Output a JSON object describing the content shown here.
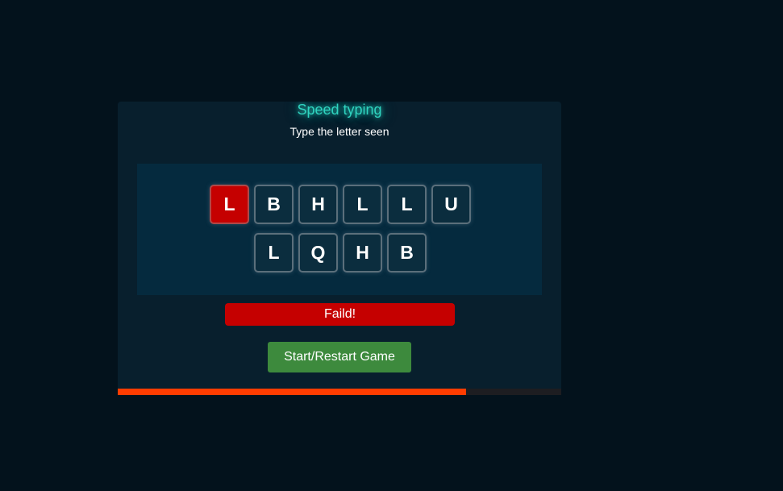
{
  "game": {
    "title": "Speed typing",
    "subtitle": "Type the letter seen",
    "letters_row1": [
      "L",
      "B",
      "H",
      "L",
      "L",
      "U"
    ],
    "letters_row2": [
      "L",
      "Q",
      "H",
      "B"
    ],
    "active_index": 0,
    "status": "Faild!",
    "start_button": "Start/Restart Game",
    "time_remaining_fraction": 0.785
  },
  "colors": {
    "background": "#03121c",
    "panel": "#081f2d",
    "board": "#052a3e",
    "title_glow": "#2fd4c0",
    "active_tile": "#c50000",
    "status_fail": "#c50000",
    "start_button": "#3d8a3d",
    "progress_fill": "#ff3c00"
  }
}
